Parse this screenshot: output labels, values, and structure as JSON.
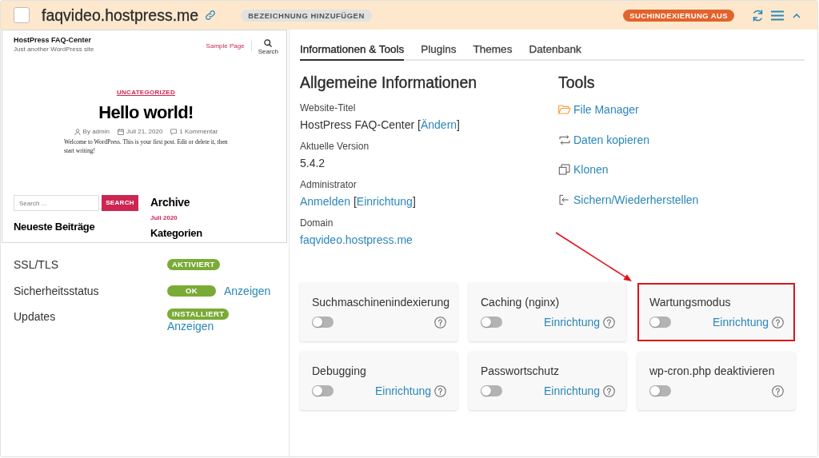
{
  "header": {
    "checked": false,
    "title": "faqvideo.hostpress.me",
    "label_button": "BEZEICHNUNG HINZUFÜGEN",
    "status_badge": "SUCHINDEXIERUNG AUS"
  },
  "preview": {
    "site_title": "HostPress FAQ-Center",
    "tagline": "Just another WordPress site",
    "nav_link": "Sample Page",
    "search_label": "Search",
    "category": "UNCATEGORIZED",
    "post_title": "Hello world!",
    "meta": [
      {
        "kind": "author",
        "text": "By admin"
      },
      {
        "kind": "date",
        "text": "Juli 21, 2020"
      },
      {
        "kind": "comments",
        "text": "1 Kommentar"
      }
    ],
    "excerpt": "Welcome to WordPress. This is your first post. Edit or delete it, then start writing!",
    "search_placeholder": "Search ...",
    "search_button": "SEARCH",
    "recent_heading": "Neueste Beiträge",
    "archive_heading": "Archive",
    "archive_link": "Juli 2020",
    "categories_heading": "Kategorien"
  },
  "status_rows": [
    {
      "label": "SSL/TLS",
      "badge": "AKTIVIERT"
    },
    {
      "label": "Sicherheitsstatus",
      "badge": "OK",
      "link": "Anzeigen"
    },
    {
      "label": "Updates",
      "badge": "INSTALLIERT",
      "link": "Anzeigen"
    }
  ],
  "tabs": [
    {
      "label": "Informationen & Tools",
      "selected": true
    },
    {
      "label": "Plugins",
      "selected": false
    },
    {
      "label": "Themes",
      "selected": false
    },
    {
      "label": "Datenbank",
      "selected": false
    }
  ],
  "info": {
    "heading": "Allgemeine Informationen",
    "fields": [
      {
        "label": "Website-Titel",
        "parts": [
          {
            "kind": "text",
            "text": "HostPress FAQ-Center ["
          },
          {
            "kind": "link",
            "text": "Ändern"
          },
          {
            "kind": "text",
            "text": "]"
          }
        ]
      },
      {
        "label": "Aktuelle Version",
        "parts": [
          {
            "kind": "text",
            "text": "5.4.2"
          }
        ]
      },
      {
        "label": "Administrator",
        "parts": [
          {
            "kind": "link",
            "text": "Anmelden"
          },
          {
            "kind": "text",
            "text": " ["
          },
          {
            "kind": "link",
            "text": "Einrichtung"
          },
          {
            "kind": "text",
            "text": "]"
          }
        ]
      },
      {
        "label": "Domain",
        "parts": [
          {
            "kind": "link",
            "text": "faqvideo.hostpress.me"
          }
        ]
      }
    ]
  },
  "tools": {
    "heading": "Tools",
    "items": [
      {
        "kind": "folder",
        "label": "File Manager"
      },
      {
        "kind": "transfer",
        "label": "Daten kopieren"
      },
      {
        "kind": "clone",
        "label": "Klonen"
      },
      {
        "kind": "restore",
        "label": "Sichern/Wiederherstellen"
      }
    ]
  },
  "cards": [
    {
      "title": "Suchmaschinenindexierung",
      "on": false,
      "highlighted": false
    },
    {
      "title": "Caching (nginx)",
      "on": false,
      "link": "Einrichtung",
      "highlighted": false
    },
    {
      "title": "Wartungsmodus",
      "on": false,
      "link": "Einrichtung",
      "highlighted": true
    },
    {
      "title": "Debugging",
      "on": false,
      "link": "Einrichtung",
      "highlighted": false
    },
    {
      "title": "Passwortschutz",
      "on": false,
      "link": "Einrichtung",
      "highlighted": false
    },
    {
      "title": "wp-cron.php deaktivieren",
      "on": false,
      "highlighted": false
    }
  ]
}
